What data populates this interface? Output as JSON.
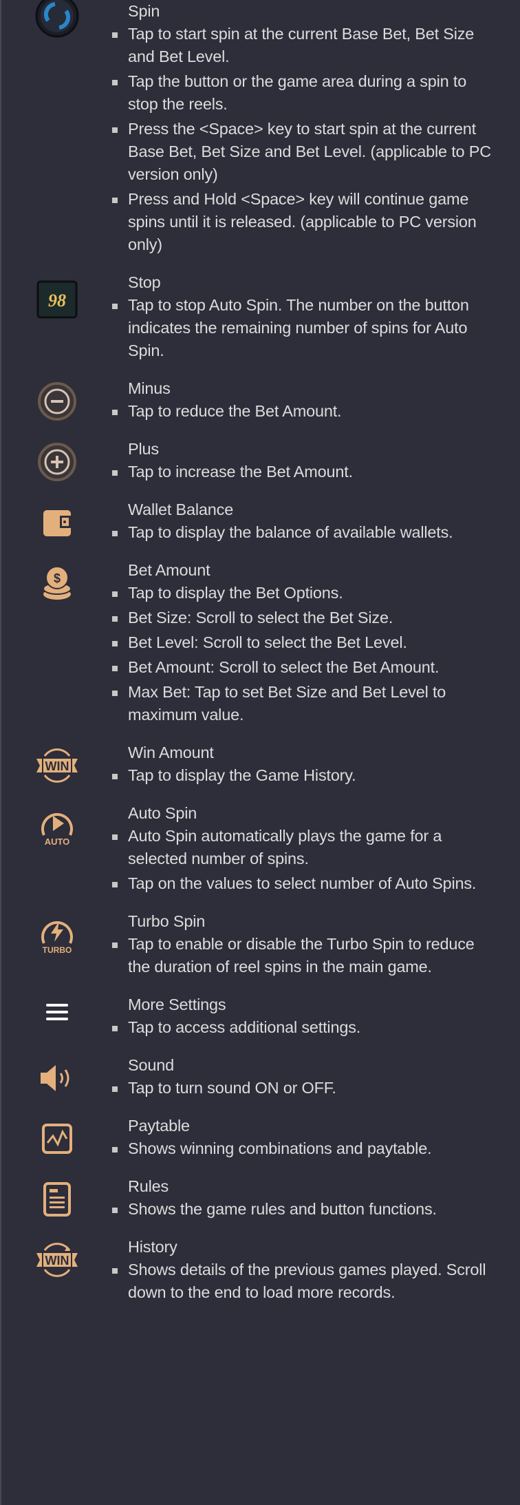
{
  "accent_color": "#e3b07c",
  "sections": [
    {
      "icon": "spin-icon",
      "title": "Spin",
      "bullets": [
        "Tap to start spin at the current Base Bet, Bet Size and Bet Level.",
        "Tap the button or the game area during a spin to stop the reels.",
        "Press the <Space> key to start spin at the current Base Bet, Bet Size and Bet Level. (applicable to PC version only)",
        "Press and Hold <Space> key will continue game spins until it is released. (applicable to PC version only)"
      ]
    },
    {
      "icon": "stop-icon",
      "icon_text": "98",
      "title": "Stop",
      "bullets": [
        "Tap to stop Auto Spin. The number on the button indicates the remaining number of spins for Auto Spin."
      ]
    },
    {
      "icon": "minus-icon",
      "title": "Minus",
      "bullets": [
        "Tap to reduce the Bet Amount."
      ]
    },
    {
      "icon": "plus-icon",
      "title": "Plus",
      "bullets": [
        "Tap to increase the Bet Amount."
      ]
    },
    {
      "icon": "wallet-icon",
      "title": "Wallet Balance",
      "bullets": [
        "Tap to display the balance of available wallets."
      ]
    },
    {
      "icon": "coins-icon",
      "title": "Bet Amount",
      "bullets": [
        "Tap to display the Bet Options.",
        "Bet Size: Scroll to select the Bet Size.",
        "Bet Level: Scroll to select the Bet Level.",
        "Bet Amount: Scroll to select the Bet Amount.",
        "Max Bet: Tap to set Bet Size and Bet Level to maximum value."
      ]
    },
    {
      "icon": "win-icon",
      "icon_text": "WIN",
      "title": "Win Amount",
      "bullets": [
        "Tap to display the Game History."
      ]
    },
    {
      "icon": "auto-spin-icon",
      "icon_text": "AUTO",
      "title": "Auto Spin",
      "bullets": [
        "Auto Spin automatically plays the game for a selected number of spins.",
        "Tap on the values to select number of Auto Spins."
      ]
    },
    {
      "icon": "turbo-icon",
      "icon_text": "TURBO",
      "title": "Turbo Spin",
      "bullets": [
        "Tap to enable or disable the Turbo Spin to reduce the duration of reel spins in the main game."
      ]
    },
    {
      "icon": "menu-icon",
      "title": "More Settings",
      "bullets": [
        "Tap to access additional settings."
      ]
    },
    {
      "icon": "sound-icon",
      "title": "Sound",
      "bullets": [
        "Tap to turn sound ON or OFF."
      ]
    },
    {
      "icon": "paytable-icon",
      "title": "Paytable",
      "bullets": [
        "Shows winning combinations and paytable."
      ]
    },
    {
      "icon": "rules-icon",
      "title": "Rules",
      "bullets": [
        "Shows the game rules and button functions."
      ]
    },
    {
      "icon": "history-icon",
      "icon_text": "WIN",
      "title": "History",
      "bullets": [
        "Shows details of the previous games played. Scroll down to the end to load more records."
      ]
    }
  ]
}
